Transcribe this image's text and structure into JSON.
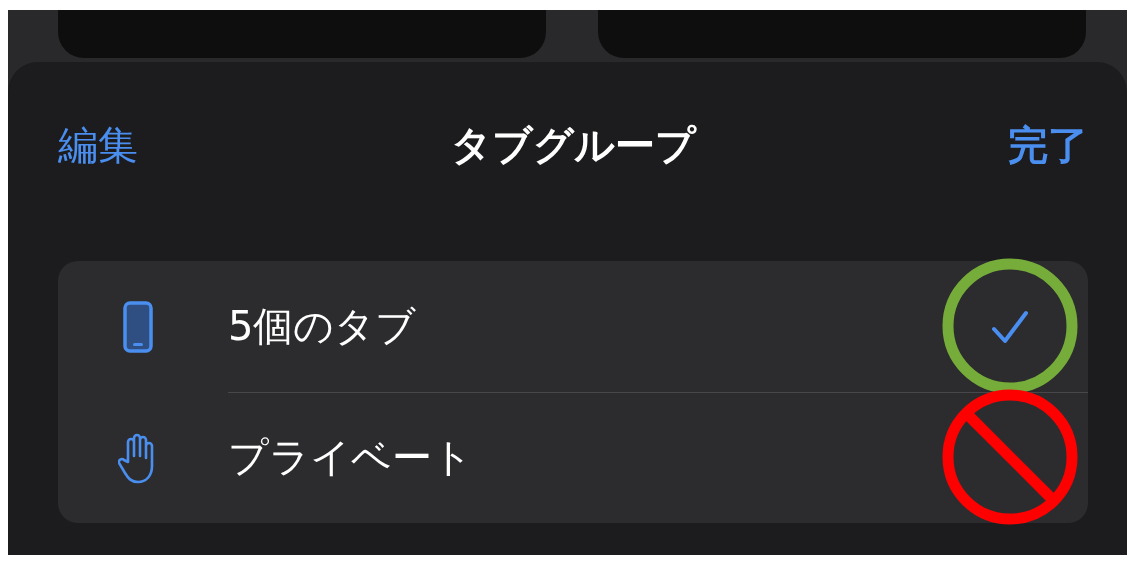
{
  "header": {
    "edit_button": "編集",
    "title": "タブグループ",
    "done_button": "完了"
  },
  "groups": [
    {
      "label": "5個のタブ",
      "kind": "phone",
      "selected": true,
      "annotation": {
        "kind": "circle",
        "color": "#76ad3a"
      }
    },
    {
      "label": "プライベート",
      "kind": "hand",
      "selected": false,
      "annotation": {
        "kind": "prohibition",
        "color": "#ff0000"
      }
    }
  ]
}
